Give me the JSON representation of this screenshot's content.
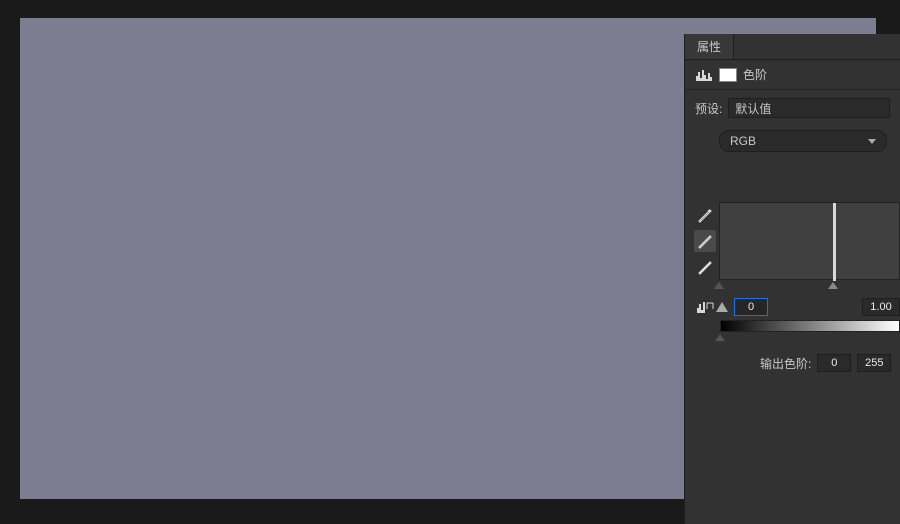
{
  "panel": {
    "title": "属性",
    "adjustment_label": "色阶",
    "preset_label": "预设:",
    "preset_value": "默认值",
    "channel_value": "RGB",
    "input_black": "0",
    "input_gamma": "1.00",
    "output_label": "输出色阶:",
    "output_black": "0",
    "output_white": "255"
  },
  "canvas": {
    "fill_color": "#7d7d92"
  }
}
